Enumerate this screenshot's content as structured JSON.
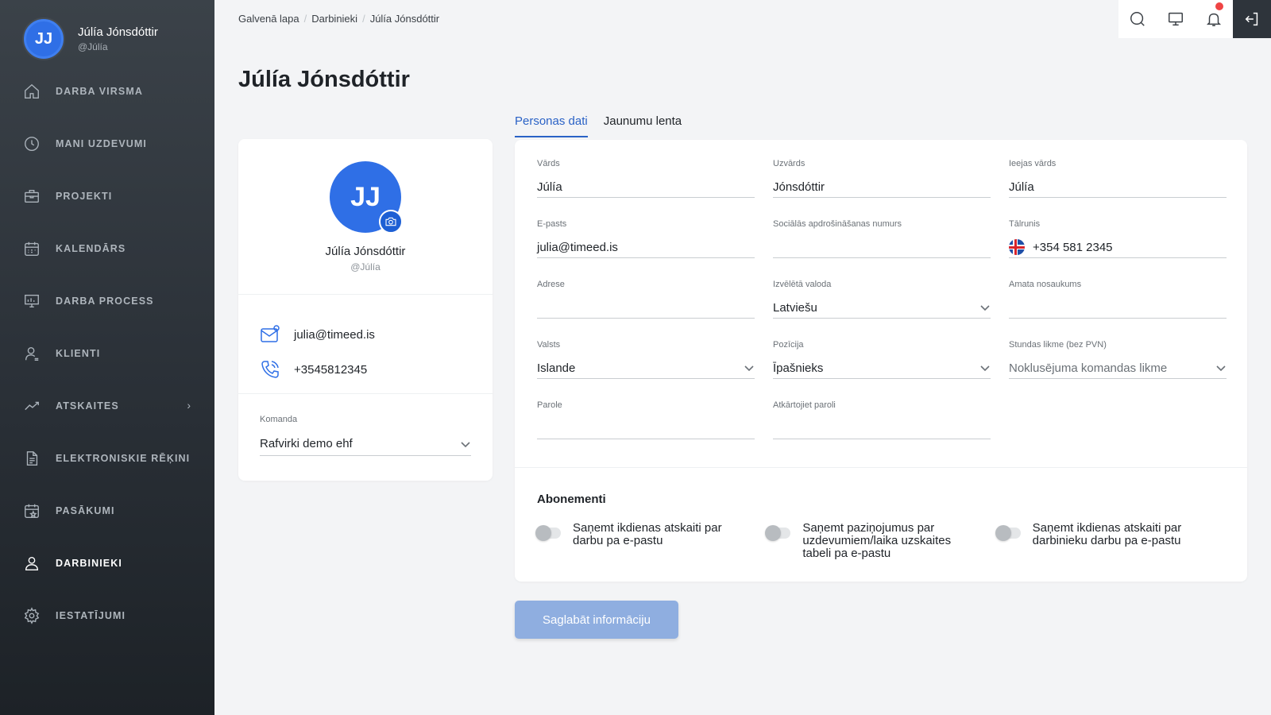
{
  "user": {
    "initials": "JJ",
    "name": "Júlía Jónsdóttir",
    "handle": "@Júlía"
  },
  "sidebar": {
    "items": [
      {
        "label": "DARBA VIRSMA",
        "icon": "home-icon"
      },
      {
        "label": "MANI UZDEVUMI",
        "icon": "clock-icon"
      },
      {
        "label": "PROJEKTI",
        "icon": "briefcase-icon"
      },
      {
        "label": "KALENDĀRS",
        "icon": "calendar-icon"
      },
      {
        "label": "DARBA PROCESS",
        "icon": "presentation-board-icon"
      },
      {
        "label": "KLIENTI",
        "icon": "client-user-icon"
      },
      {
        "label": "ATSKAITES",
        "icon": "trend-chart-icon"
      },
      {
        "label": "ELEKTRONISKIE RĒĶINI",
        "icon": "document-icon"
      },
      {
        "label": "PASĀKUMI",
        "icon": "calendar-star-icon"
      },
      {
        "label": "DARBINIEKI",
        "icon": "employees-icon",
        "active": true
      },
      {
        "label": "IESTATĪJUMI",
        "icon": "gear-icon"
      }
    ]
  },
  "breadcrumb": {
    "home": "Galvenā lapa",
    "section": "Darbinieki",
    "current": "Júlía Jónsdóttir",
    "separator": "/"
  },
  "page": {
    "title": "Júlía Jónsdóttir"
  },
  "profile": {
    "initials": "JJ",
    "name": "Júlía Jónsdóttir",
    "handle": "@Júlía",
    "email": "julia@timeed.is",
    "phone": "+3545812345",
    "team_label": "Komanda",
    "team_value": "Rafvirki demo ehf"
  },
  "tabs": {
    "personal": "Personas dati",
    "feed": "Jaunumu lenta"
  },
  "form": {
    "first_name": {
      "label": "Vārds",
      "value": "Júlía"
    },
    "last_name": {
      "label": "Uzvārds",
      "value": "Jónsdóttir"
    },
    "username": {
      "label": "Ieejas vārds",
      "value": "Júlía"
    },
    "email": {
      "label": "E-pasts",
      "value": "julia@timeed.is"
    },
    "ssn": {
      "label": "Sociālās apdrošināšanas numurs",
      "value": ""
    },
    "phone": {
      "label": "Tālrunis",
      "value": "+354 581 2345"
    },
    "address": {
      "label": "Adrese",
      "value": ""
    },
    "language": {
      "label": "Izvēlētā valoda",
      "value": "Latviešu"
    },
    "job_title": {
      "label": "Amata nosaukums",
      "value": ""
    },
    "country": {
      "label": "Valsts",
      "value": "Islande"
    },
    "position": {
      "label": "Pozīcija",
      "value": "Īpašnieks"
    },
    "hourly_rate": {
      "label": "Stundas likme (bez PVN)",
      "value": "Noklusējuma komandas likme"
    },
    "password": {
      "label": "Parole",
      "value": ""
    },
    "password_repeat": {
      "label": "Atkārtojiet paroli",
      "value": ""
    }
  },
  "subscriptions": {
    "title": "Abonementi",
    "items": [
      {
        "label": "Saņemt ikdienas atskaiti par darbu pa e-pastu",
        "enabled": false
      },
      {
        "label": "Saņemt paziņojumus par uzdevumiem/laika uzskaites tabeli pa e-pastu",
        "enabled": false
      },
      {
        "label": "Saņemt ikdienas atskaiti par darbinieku darbu pa e-pastu",
        "enabled": false
      }
    ]
  },
  "actions": {
    "save": "Saglabāt informāciju"
  },
  "colors": {
    "accent": "#2f6fe6",
    "sidebar_bg": "#2a3037",
    "save_button": "#8faee0",
    "notification": "#ef4444"
  }
}
